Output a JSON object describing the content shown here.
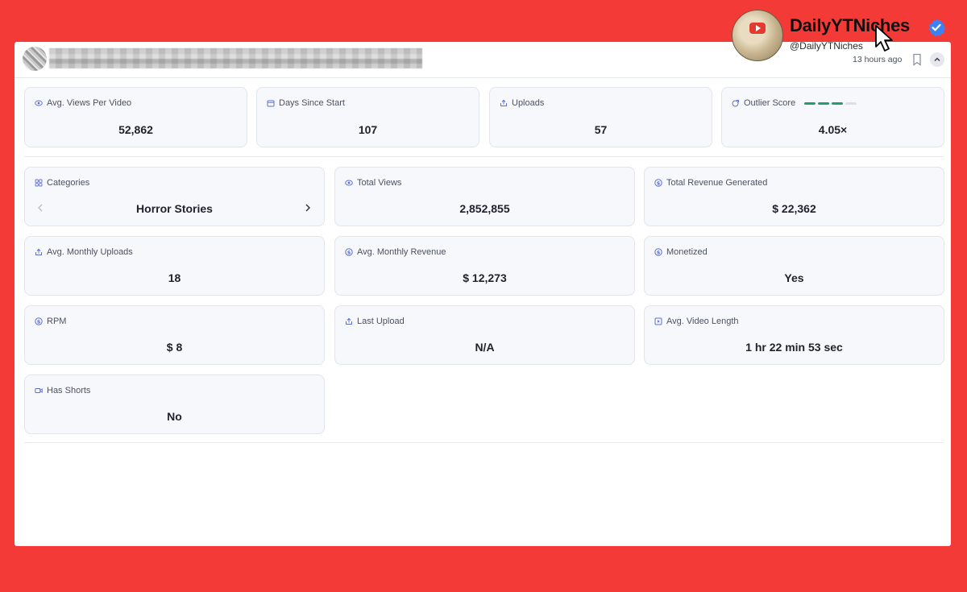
{
  "header": {
    "timestamp": "13 hours ago"
  },
  "overlay": {
    "name": "DailyYTNiches",
    "handle": "@DailyYTNiches"
  },
  "top_stats": [
    {
      "label": "Avg. Views Per Video",
      "value": "52,862",
      "icon": "eye-icon"
    },
    {
      "label": "Days Since Start",
      "value": "107",
      "icon": "calendar-icon"
    },
    {
      "label": "Uploads",
      "value": "57",
      "icon": "upload-icon"
    },
    {
      "label": "Outlier Score",
      "value": "4.05×",
      "icon": "outlier-icon",
      "score_filled": 3,
      "score_total": 4
    }
  ],
  "categories": {
    "label": "Categories",
    "value": "Horror Stories"
  },
  "stats": [
    {
      "label": "Total Views",
      "value": "2,852,855",
      "icon": "eye-icon"
    },
    {
      "label": "Total Revenue Generated",
      "value": "$ 22,362",
      "icon": "dollar-icon"
    },
    {
      "label": "Avg. Monthly Uploads",
      "value": "18",
      "icon": "upload-icon"
    },
    {
      "label": "Avg. Monthly Revenue",
      "value": "$ 12,273",
      "icon": "dollar-icon"
    },
    {
      "label": "Monetized",
      "value": "Yes",
      "icon": "dollar-icon"
    },
    {
      "label": "RPM",
      "value": "$ 8",
      "icon": "dollar-icon"
    },
    {
      "label": "Last Upload",
      "value": "N/A",
      "icon": "upload-icon"
    },
    {
      "label": "Avg. Video Length",
      "value": "1 hr 22 min 53 sec",
      "icon": "play-icon"
    },
    {
      "label": "Has Shorts",
      "value": "No",
      "icon": "video-icon"
    }
  ],
  "colors": {
    "accent": "#5b6fd6",
    "score_on": "#22a06b",
    "score_off": "#dcdfe6",
    "background": "#f43a37"
  }
}
